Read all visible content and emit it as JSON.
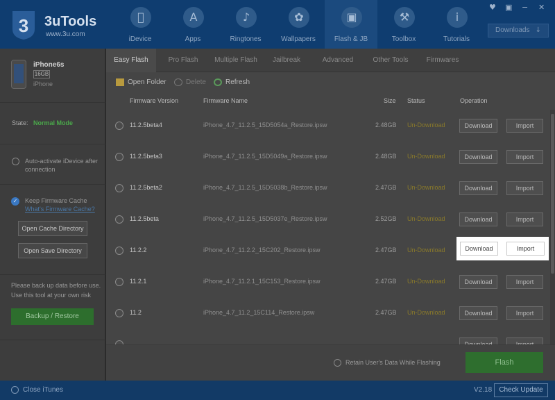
{
  "app": {
    "name": "3uTools",
    "url": "www.3u.com",
    "version": "V2.18"
  },
  "window_controls": [
    "♥",
    "▣",
    "−",
    "✕"
  ],
  "nav": {
    "items": [
      {
        "label": "iDevice",
        "icon": "apple-icon",
        "glyph": ""
      },
      {
        "label": "Apps",
        "icon": "apps-icon",
        "glyph": "A"
      },
      {
        "label": "Ringtones",
        "icon": "bell-icon",
        "glyph": "♪"
      },
      {
        "label": "Wallpapers",
        "icon": "wallpaper-icon",
        "glyph": "✿"
      },
      {
        "label": "Flash & JB",
        "icon": "box-icon",
        "glyph": "▣"
      },
      {
        "label": "Toolbox",
        "icon": "tools-icon",
        "glyph": "⚒"
      },
      {
        "label": "Tutorials",
        "icon": "info-icon",
        "glyph": "i"
      }
    ],
    "downloads_label": "Downloads",
    "downloads_arrow": "↓"
  },
  "device": {
    "name": "iPhone6s",
    "capacity": "16GB",
    "type": "iPhone"
  },
  "sidebar": {
    "state_label": "State:",
    "state_value": "Normal Mode",
    "auto_activate": "Auto-activate iDevice after connection",
    "keep_cache": "Keep Firmware Cache",
    "cache_link": "What's Firmware Cache?",
    "open_cache_dir": "Open Cache Directory",
    "open_save_dir": "Open Save Directory",
    "warning": "Please back up data before use. Use this tool at your own risk",
    "backup_restore": "Backup / Restore",
    "check_glyph": "✓"
  },
  "subtabs": [
    "Easy Flash",
    "Pro Flash",
    "Multiple Flash",
    "Jailbreak",
    "Advanced",
    "Other Tools",
    "Firmwares"
  ],
  "toolbar": {
    "open_folder": "Open Folder",
    "delete": "Delete",
    "refresh": "Refresh"
  },
  "table": {
    "headers": {
      "version": "Firmware Version",
      "name": "Firmware Name",
      "size": "Size",
      "status": "Status",
      "operation": "Operation"
    },
    "download_label": "Download",
    "import_label": "Import",
    "rows": [
      {
        "version": "11.2.5beta4",
        "name": "iPhone_4.7_11.2.5_15D5054a_Restore.ipsw",
        "size": "2.48GB",
        "status": "Un-Download"
      },
      {
        "version": "11.2.5beta3",
        "name": "iPhone_4.7_11.2.5_15D5049a_Restore.ipsw",
        "size": "2.48GB",
        "status": "Un-Download"
      },
      {
        "version": "11.2.5beta2",
        "name": "iPhone_4.7_11.2.5_15D5038b_Restore.ipsw",
        "size": "2.47GB",
        "status": "Un-Download"
      },
      {
        "version": "11.2.5beta",
        "name": "iPhone_4.7_11.2.5_15D5037e_Restore.ipsw",
        "size": "2.52GB",
        "status": "Un-Download"
      },
      {
        "version": "11.2.2",
        "name": "iPhone_4.7_11.2.2_15C202_Restore.ipsw",
        "size": "2.47GB",
        "status": "Un-Download"
      },
      {
        "version": "11.2.1",
        "name": "iPhone_4.7_11.2.1_15C153_Restore.ipsw",
        "size": "2.47GB",
        "status": "Un-Download"
      },
      {
        "version": "11.2",
        "name": "iPhone_4.7_11.2_15C114_Restore.ipsw",
        "size": "2.47GB",
        "status": "Un-Download"
      },
      {
        "version": "",
        "name": "",
        "size": "",
        "status": ""
      }
    ]
  },
  "footer": {
    "retain_data": "Retain User's Data While Flashing",
    "flash": "Flash"
  },
  "statusbar": {
    "close_itunes": "Close iTunes",
    "check_update": "Check Update"
  }
}
